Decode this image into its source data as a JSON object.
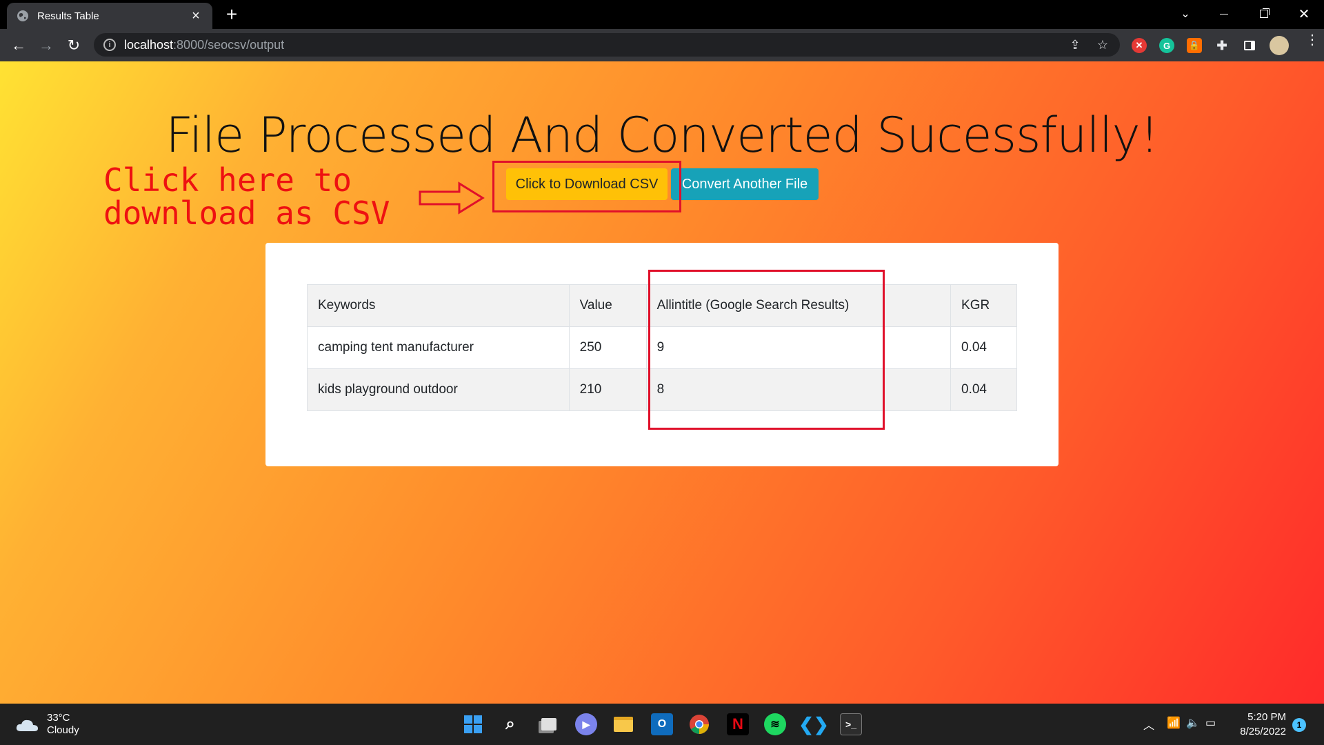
{
  "browser": {
    "tab_title": "Results Tab",
    "tab_title_full": "Results Table",
    "new_tab": "+",
    "url_host": "localhost",
    "url_rest": ":8000/seocsv/output"
  },
  "page": {
    "heading": "File Processed And Converted Sucessfully!",
    "download_button": "Click to Download CSV",
    "convert_button": "Convert Another File",
    "annotation": "Click here to\ndownload as CSV"
  },
  "table": {
    "headers": [
      "Keywords",
      "Value",
      "Allintitle (Google Search Results)",
      "KGR"
    ],
    "rows": [
      [
        "camping tent manufacturer",
        "250",
        "9",
        "0.04"
      ],
      [
        "kids playground outdoor",
        "210",
        "8",
        "0.04"
      ]
    ]
  },
  "taskbar": {
    "temperature": "33°C",
    "weather": "Cloudy",
    "time": "5:20 PM",
    "date": "8/25/2022",
    "notification_count": "1"
  },
  "colors": {
    "download_button": "#ffc107",
    "convert_button": "#17a2b8",
    "annotation": "#e0102a"
  }
}
